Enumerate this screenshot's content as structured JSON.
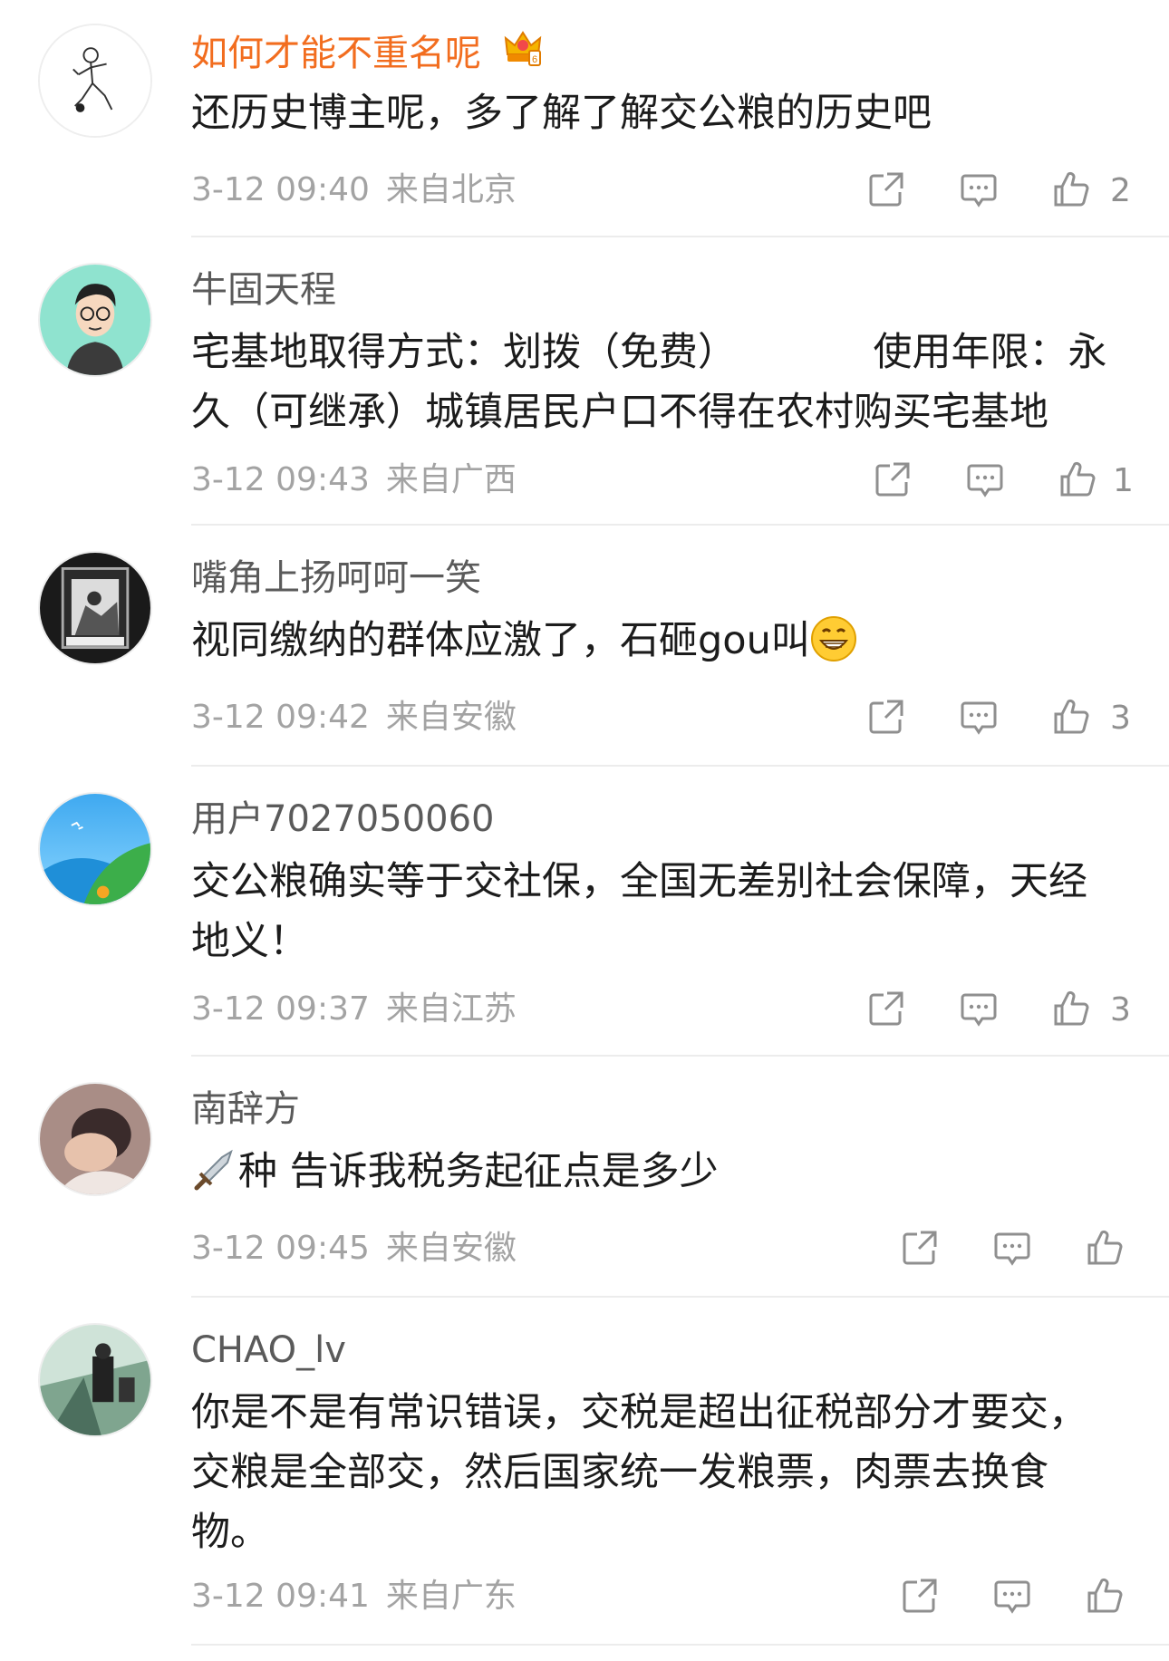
{
  "comments": [
    {
      "username": "如何才能不重名呢",
      "text": "还历史博主呢，多了解了解交公粮的历史吧",
      "time": "3-12 09:40",
      "location": "来自北京",
      "likes": "2",
      "vip": true
    },
    {
      "username": "牛固天程",
      "text": "宅基地取得方式：划拨（免费）　　　　使用年限：永久（可继承）城镇居民户口不得在农村购买宅基地",
      "time": "3-12 09:43",
      "location": "来自广西",
      "likes": "1"
    },
    {
      "username": "嘴角上扬呵呵一笑",
      "text": "视同缴纳的群体应激了，石砸gou叫",
      "time": "3-12 09:42",
      "location": "来自安徽",
      "likes": "3",
      "emoji": "grin-emoji"
    },
    {
      "username": "用户7027050060",
      "text": "交公粮确实等于交社保，全国无差别社会保障，天经地义！",
      "time": "3-12 09:37",
      "location": "来自江苏",
      "likes": "3"
    },
    {
      "username": "南辞方",
      "text": "种 告诉我税务起征点是多少",
      "time": "3-12 09:45",
      "location": "来自安徽",
      "likes": "",
      "lead_emoji": "sword-emoji"
    },
    {
      "username": "CHAO_lv",
      "text": "你是不是有常识错误，交税是超出征税部分才要交，交粮是全部交，然后国家统一发粮票，肉票去换食物。",
      "time": "3-12 09:41",
      "location": "来自广东",
      "likes": ""
    }
  ],
  "colors": {
    "vip_name": "#f26d1f",
    "username": "#5a5a5a",
    "text": "#1c1c1c",
    "meta": "#a3a3a3",
    "icon": "#8f8f8f",
    "divider": "#ececec"
  },
  "icons": [
    "share-icon",
    "comment-icon",
    "like-icon",
    "crown-icon"
  ]
}
